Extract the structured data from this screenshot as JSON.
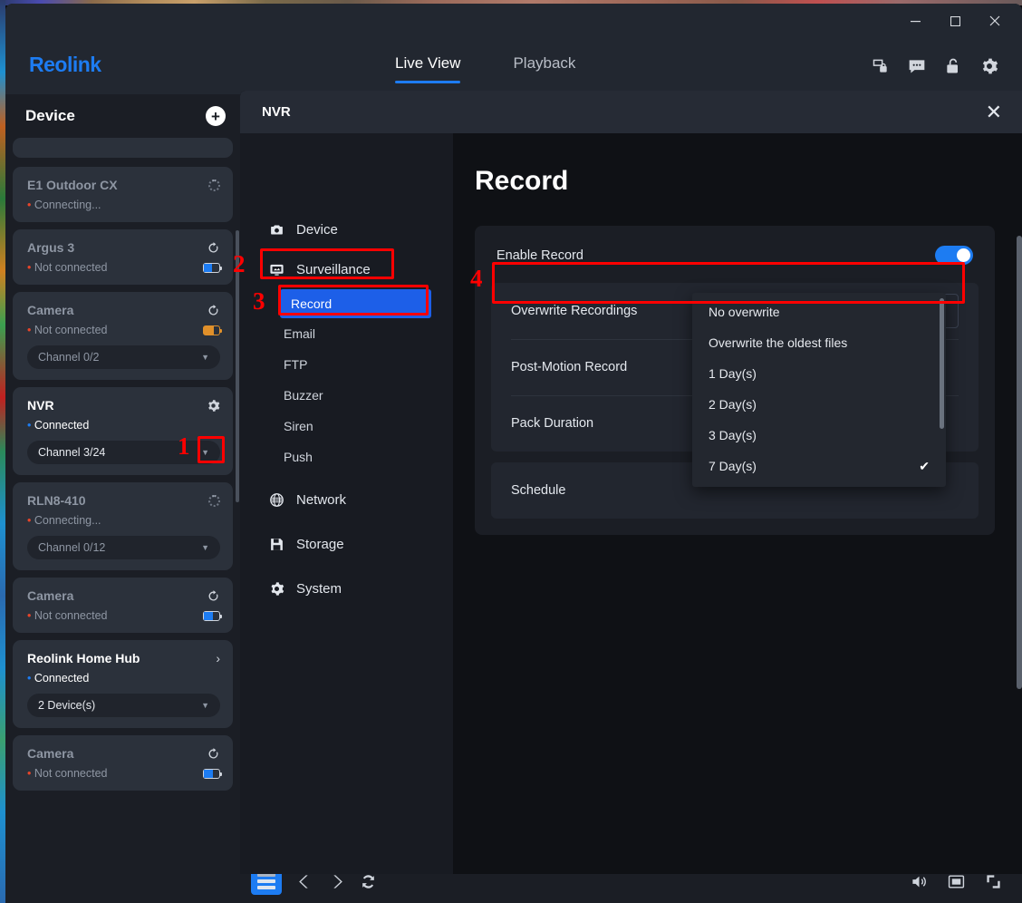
{
  "window": {
    "minimize": "—",
    "maximize": "▢",
    "close": "✕"
  },
  "navbar": {
    "brand": "Reolink",
    "tabs": [
      {
        "label": "Live View",
        "active": true
      },
      {
        "label": "Playback",
        "active": false
      }
    ],
    "icons": [
      "image-lock-icon",
      "chat-icon",
      "unlock-icon",
      "gear-icon"
    ]
  },
  "sidebar": {
    "title": "Device",
    "add_label": "+",
    "devices": [
      {
        "name": "E1 Outdoor CX",
        "status": "Connecting...",
        "state": "connecting",
        "right_icon": "spinner-icon",
        "channel": null,
        "battery": null
      },
      {
        "name": "Argus 3",
        "status": "Not connected",
        "state": "disconnected",
        "right_icon": "refresh-icon",
        "channel": null,
        "battery": "blue"
      },
      {
        "name": "Camera",
        "status": "Not connected",
        "state": "disconnected",
        "right_icon": "refresh-icon",
        "channel": "Channel 0/2",
        "battery": "orange"
      },
      {
        "name": "NVR",
        "status": "Connected",
        "state": "connected",
        "right_icon": "gear-icon",
        "channel": "Channel 3/24",
        "battery": null
      },
      {
        "name": "RLN8-410",
        "status": "Connecting...",
        "state": "connecting",
        "right_icon": "spinner-icon",
        "channel": "Channel 0/12",
        "battery": null
      },
      {
        "name": "Camera",
        "status": "Not connected",
        "state": "disconnected",
        "right_icon": "refresh-icon",
        "channel": null,
        "battery": "blue"
      },
      {
        "name": "Reolink Home Hub",
        "status": "Connected",
        "state": "connected",
        "right_icon": "chevron-right-icon",
        "channel": "2 Device(s)",
        "battery": null
      },
      {
        "name": "Camera",
        "status": "Not connected",
        "state": "disconnected",
        "right_icon": "refresh-icon",
        "channel": null,
        "battery": "blue"
      }
    ]
  },
  "bottombar": {
    "layout_label": "layout-grid-icon",
    "prev_label": "‹",
    "next_label": "›",
    "refresh_label": "refresh-icon",
    "volume_label": "volume-icon",
    "screen_label": "screen-icon",
    "fullscreen_label": "fullscreen-icon"
  },
  "modal": {
    "title": "NVR",
    "close": "✕",
    "nav": [
      {
        "label": "Device",
        "icon": "camera-icon",
        "type": "section"
      },
      {
        "label": "Surveillance",
        "icon": "monitor-icon",
        "type": "section",
        "highlighted": true
      },
      {
        "label": "Record",
        "type": "sub",
        "selected": true
      },
      {
        "label": "Email",
        "type": "sub"
      },
      {
        "label": "FTP",
        "type": "sub"
      },
      {
        "label": "Buzzer",
        "type": "sub"
      },
      {
        "label": "Siren",
        "type": "sub"
      },
      {
        "label": "Push",
        "type": "sub"
      },
      {
        "label": "Network",
        "icon": "globe-icon",
        "type": "section"
      },
      {
        "label": "Storage",
        "icon": "save-icon",
        "type": "section"
      },
      {
        "label": "System",
        "icon": "gear-icon",
        "type": "section"
      }
    ],
    "content": {
      "title": "Record",
      "enable_record_label": "Enable Record",
      "enable_record_on": true,
      "rows": [
        {
          "label": "Overwrite Recordings",
          "value": "7 Day(s)",
          "expanded": true
        },
        {
          "label": "Post-Motion Record",
          "value": ""
        },
        {
          "label": "Pack Duration",
          "value": ""
        }
      ],
      "schedule_label": "Schedule",
      "dropdown": {
        "options": [
          {
            "label": "No overwrite",
            "checked": false
          },
          {
            "label": "Overwrite the oldest files",
            "checked": false
          },
          {
            "label": "1 Day(s)",
            "checked": false
          },
          {
            "label": "2 Day(s)",
            "checked": false
          },
          {
            "label": "3 Day(s)",
            "checked": false
          },
          {
            "label": "7 Day(s)",
            "checked": true
          }
        ],
        "check_glyph": "✔"
      }
    }
  },
  "annotations": [
    {
      "number": "1",
      "target": "nvr-settings-gear"
    },
    {
      "number": "2",
      "target": "surveillance-nav-item"
    },
    {
      "number": "3",
      "target": "record-nav-item"
    },
    {
      "number": "4",
      "target": "overwrite-recordings-row"
    }
  ],
  "colors": {
    "accent": "#1d7cf2",
    "annotation": "#ff0000",
    "connected": "#1d7cf2",
    "disconnected": "#e8452a"
  }
}
